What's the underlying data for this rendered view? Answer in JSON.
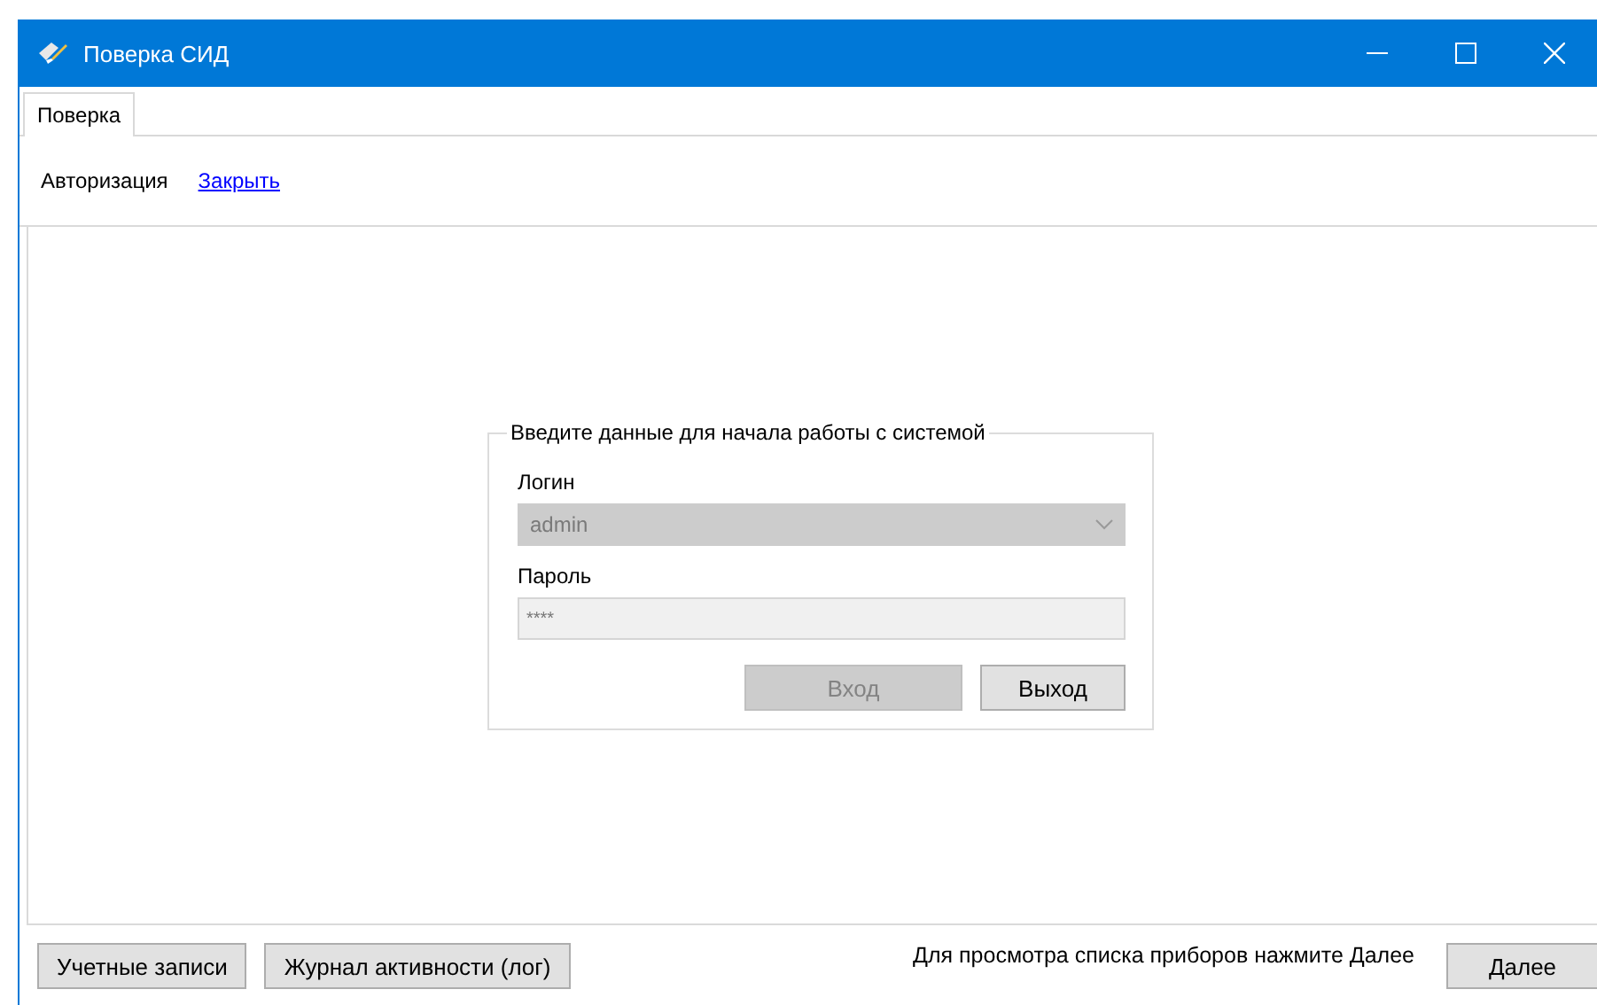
{
  "window": {
    "title": "Поверка СИД"
  },
  "tabs": [
    {
      "label": "Поверка",
      "selected": true
    }
  ],
  "toolbar": {
    "label": "Авторизация",
    "link": "Закрыть"
  },
  "login_group": {
    "title": "Введите данные для начала работы с системой",
    "login": {
      "label": "Логин",
      "value": "admin",
      "disabled": true
    },
    "password": {
      "label": "Пароль",
      "value": "****",
      "disabled": false
    },
    "buttons": [
      {
        "label": "Вход",
        "disabled": true
      },
      {
        "label": "Выход",
        "disabled": false
      }
    ]
  },
  "footer": {
    "buttons": [
      {
        "label": "Учетные записи"
      },
      {
        "label": "Журнал активности (лог)"
      }
    ],
    "hint": "Для просмотра списка приборов нажмите Далее",
    "next": {
      "label": "Далее"
    }
  }
}
